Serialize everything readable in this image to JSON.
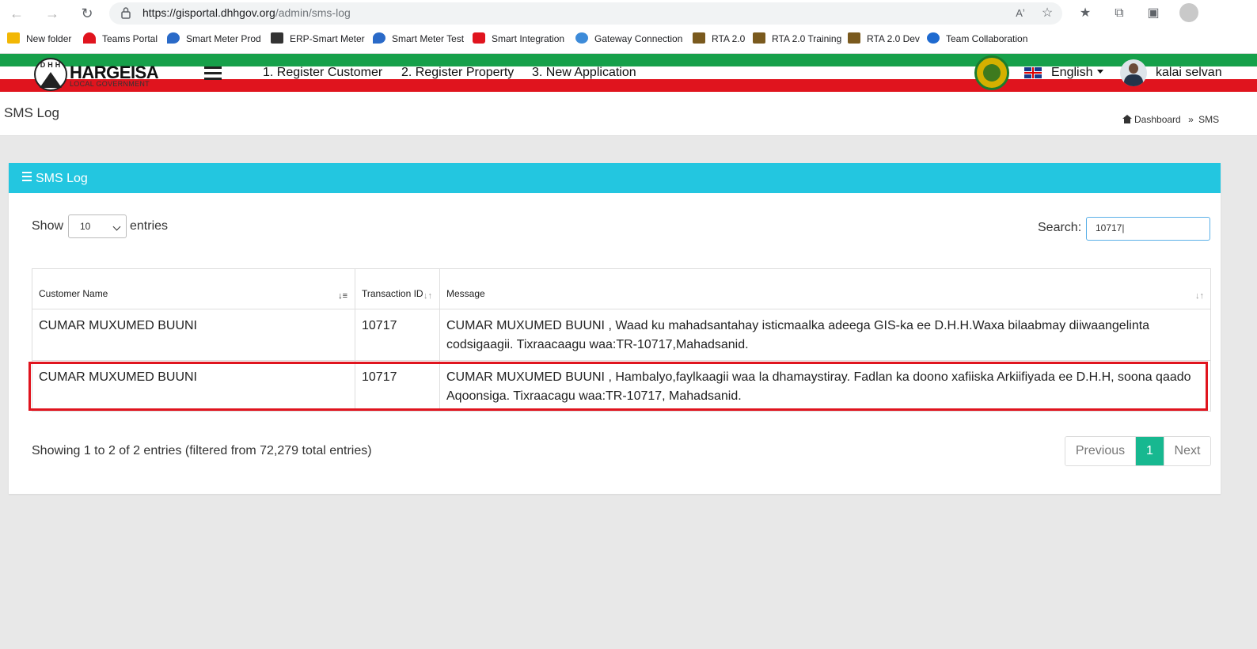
{
  "browser": {
    "url_host": "https://gisportal.dhhgov.org",
    "url_path": "/admin/sms-log",
    "bookmarks": [
      {
        "label": "New folder",
        "color": "#f2b705"
      },
      {
        "label": "Teams Portal",
        "color": "#e0141e"
      },
      {
        "label": "Smart Meter Prod",
        "color": "#2a6ac8"
      },
      {
        "label": "ERP-Smart Meter",
        "color": "#333333"
      },
      {
        "label": "Smart Meter Test",
        "color": "#2a6ac8"
      },
      {
        "label": "Smart Integration",
        "color": "#e0141e"
      },
      {
        "label": "Gateway Connection",
        "color": "#3d8bd9"
      },
      {
        "label": "RTA 2.0",
        "color": "#7a5a1e"
      },
      {
        "label": "RTA 2.0 Training",
        "color": "#7a5a1e"
      },
      {
        "label": "RTA 2.0 Dev",
        "color": "#7a5a1e"
      },
      {
        "label": "Team Collaboration",
        "color": "#1e6ad0"
      }
    ]
  },
  "header": {
    "logo_text": "HARGEISA",
    "logo_initials": "DHH",
    "logo_sub": "LOCAL GOVERNMENT",
    "menu": [
      "1. Register Customer",
      "2. Register Property",
      "3. New Application"
    ],
    "language": "English",
    "user_name": "kalai selvan"
  },
  "page": {
    "title": "SMS Log",
    "breadcrumb_home": "Dashboard",
    "breadcrumb_sep": "»",
    "breadcrumb_current": "SMS"
  },
  "card": {
    "title": "SMS Log",
    "show_label": "Show",
    "entries_value": "10",
    "entries_label": "entries",
    "search_label": "Search:",
    "search_value": "10717|"
  },
  "table": {
    "columns": [
      "Customer Name",
      "Transaction ID",
      "Message"
    ],
    "rows": [
      {
        "name": "CUMAR MUXUMED BUUNI",
        "id": "10717",
        "message": "CUMAR MUXUMED BUUNI , Waad ku mahadsantahay isticmaalka adeega GIS-ka ee D.H.H.Waxa bilaabmay diiwaangelinta codsigaagii. Tixraacaagu waa:TR-10717,Mahadsanid."
      },
      {
        "name": "CUMAR MUXUMED BUUNI",
        "id": "10717",
        "message": "CUMAR MUXUMED BUUNI , Hambalyo,faylkaagii waa la dhamaystiray. Fadlan ka doono xafiiska Arkiifiyada ee D.H.H, soona qaado Aqoonsiga. Tixraacagu waa:TR-10717, Mahadsanid."
      }
    ]
  },
  "footer": {
    "info": "Showing 1 to 2 of 2 entries (filtered from 72,279 total entries)",
    "prev": "Previous",
    "page": "1",
    "next": "Next"
  },
  "colors": {
    "accent": "#23c6e0",
    "pager_active": "#17b890",
    "highlight": "#e0141e"
  }
}
